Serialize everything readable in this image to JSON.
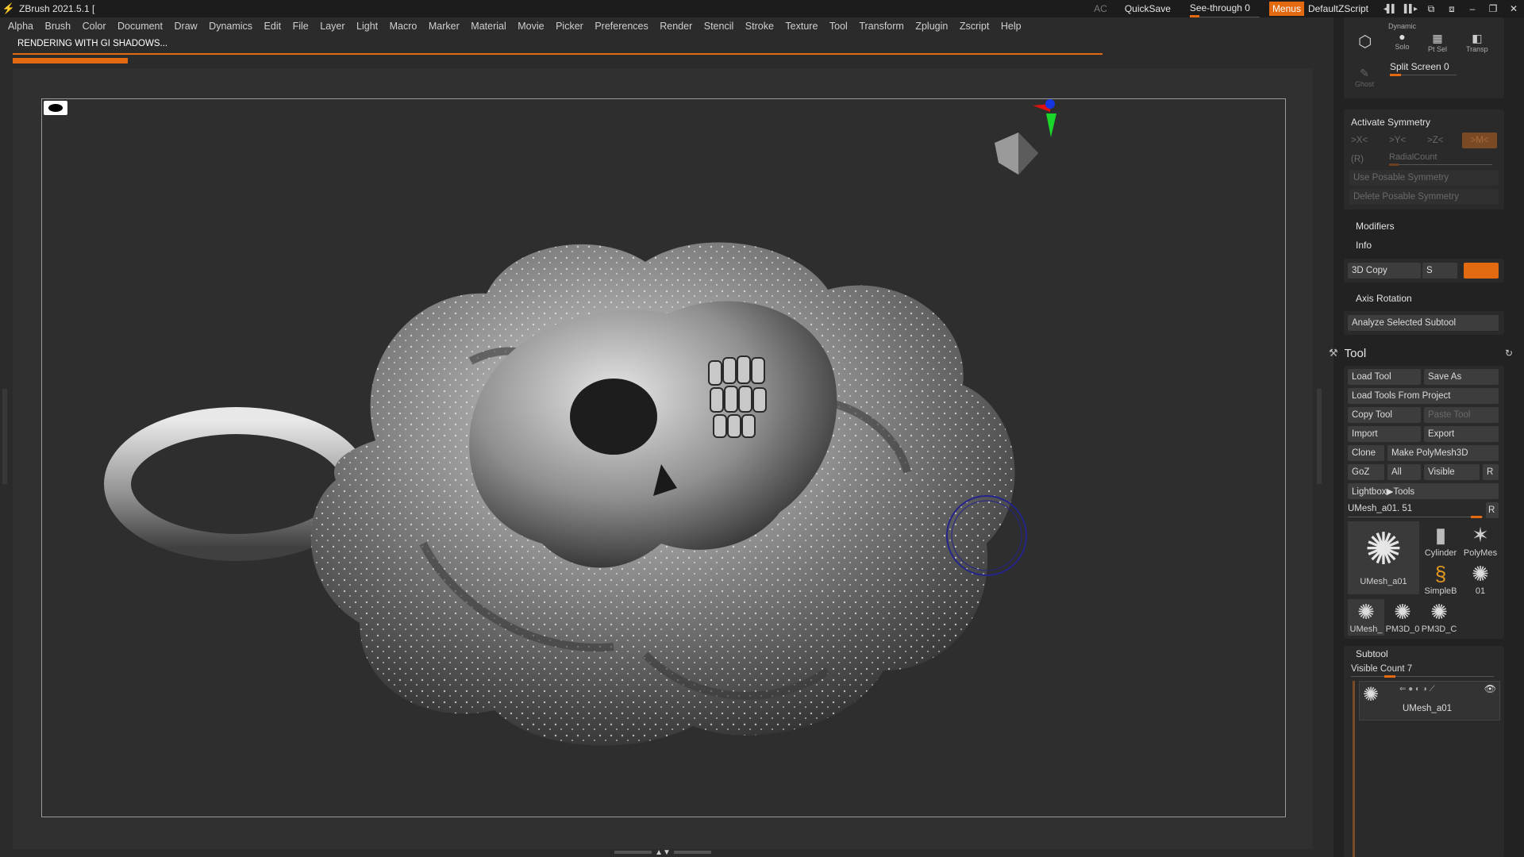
{
  "app": {
    "title": "ZBrush 2021.5.1 [",
    "ac_label": "AC",
    "quicksave_label": "QuickSave",
    "see_through_label": "See-through  0",
    "menus_label": "Menus",
    "default_zscript_label": "DefaultZScript"
  },
  "menu": [
    "Alpha",
    "Brush",
    "Color",
    "Document",
    "Draw",
    "Dynamics",
    "Edit",
    "File",
    "Layer",
    "Light",
    "Macro",
    "Marker",
    "Material",
    "Movie",
    "Picker",
    "Preferences",
    "Render",
    "Stencil",
    "Stroke",
    "Texture",
    "Tool",
    "Transform",
    "Zplugin",
    "Zscript",
    "Help"
  ],
  "status": {
    "text": "RENDERING WITH GI SHADOWS..."
  },
  "right_tray": {
    "top_icons": {
      "dynamic_label": "Dynamic",
      "solo_label": "Solo",
      "ptsel_label": "Pt Sel",
      "transp_label": "Transp",
      "ghost_label": "Ghost",
      "split_screen_label": "Split Screen 0"
    },
    "symmetry": {
      "activate_label": "Activate Symmetry",
      "x_label": ">X<",
      "y_label": ">Y<",
      "z_label": ">Z<",
      "m_label": ">M<",
      "r_label": "(R)",
      "radial_label": "RadialCount",
      "use_posable_label": "Use Posable Symmetry",
      "delete_posable_label": "Delete Posable Symmetry"
    },
    "modifiers_label": "Modifiers",
    "info_label": "Info",
    "copy3d_label": "3D Copy",
    "s_label": "S",
    "axis_rotation_label": "Axis Rotation",
    "analyze_label": "Analyze Selected Subtool",
    "tool": {
      "header": "Tool",
      "load_tool": "Load Tool",
      "save_as": "Save As",
      "load_from_project": "Load Tools From Project",
      "copy_tool": "Copy Tool",
      "paste_tool": "Paste Tool",
      "import": "Import",
      "export": "Export",
      "clone": "Clone",
      "make_polymesh": "Make PolyMesh3D",
      "goz": "GoZ",
      "all": "All",
      "visible": "Visible",
      "r": "R",
      "lightbox_tools": "Lightbox▶Tools",
      "current_tool": "UMesh_a01. 51",
      "current_r": "R",
      "thumbs": {
        "main": "UMesh_a01",
        "cylinder": "Cylinder",
        "polymesh": "PolyMes",
        "simpleb": "SimpleB",
        "small_01": "01",
        "umesh": "UMesh_",
        "pm3d_0": "PM3D_0",
        "pm3d_c": "PM3D_C"
      }
    },
    "subtool": {
      "header": "Subtool",
      "visible_count": "Visible Count 7",
      "item_name": "UMesh_a01"
    }
  },
  "colors": {
    "accent": "#e36a10",
    "background": "#2b2b2b",
    "panel": "#2a2a2a"
  }
}
